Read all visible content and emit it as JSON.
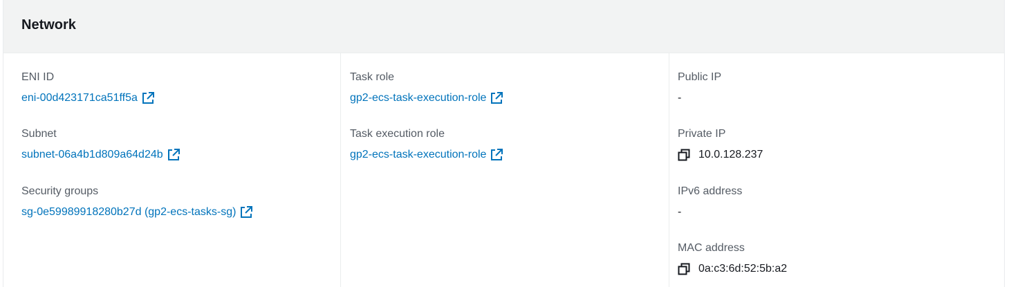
{
  "panel": {
    "title": "Network"
  },
  "columns": {
    "left": {
      "eni": {
        "label": "ENI ID",
        "value": "eni-00d423171ca51ff5a",
        "icon": "external-link-icon"
      },
      "subnet": {
        "label": "Subnet",
        "value": "subnet-06a4b1d809a64d24b",
        "icon": "external-link-icon"
      },
      "security_groups": {
        "label": "Security groups",
        "value": "sg-0e59989918280b27d (gp2-ecs-tasks-sg)",
        "icon": "external-link-icon"
      }
    },
    "middle": {
      "task_role": {
        "label": "Task role",
        "value": "gp2-ecs-task-execution-role",
        "icon": "external-link-icon"
      },
      "task_execution_role": {
        "label": "Task execution role",
        "value": "gp2-ecs-task-execution-role",
        "icon": "external-link-icon"
      }
    },
    "right": {
      "public_ip": {
        "label": "Public IP",
        "value": "-"
      },
      "private_ip": {
        "label": "Private IP",
        "value": "10.0.128.237",
        "icon": "copy-icon"
      },
      "ipv6": {
        "label": "IPv6 address",
        "value": "-"
      },
      "mac": {
        "label": "MAC address",
        "value": "0a:c3:6d:52:5b:a2",
        "icon": "copy-icon"
      }
    }
  },
  "colors": {
    "link": "#0073bb",
    "label": "#545b64",
    "text": "#16191f",
    "header_bg": "#f2f3f3"
  }
}
